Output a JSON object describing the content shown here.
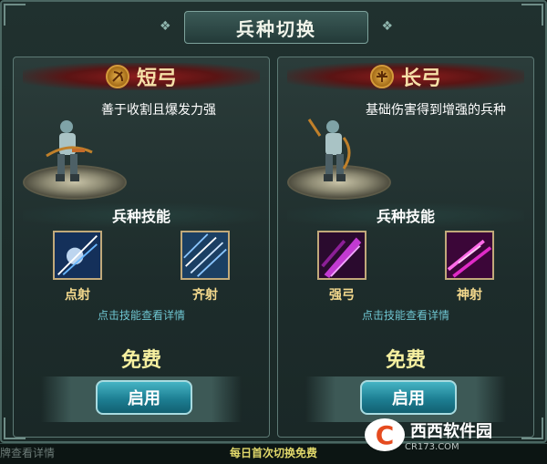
{
  "window": {
    "title": "兵种切换"
  },
  "panels": [
    {
      "type_name": "短弓",
      "description": "善于收割且爆发力强",
      "skills_heading": "兵种技能",
      "skills": [
        {
          "label": "点射"
        },
        {
          "label": "齐射"
        }
      ],
      "hint": "点击技能查看详情",
      "cost": "免费",
      "button_label": "启用"
    },
    {
      "type_name": "长弓",
      "description": "基础伤害得到增强的兵种",
      "skills_heading": "兵种技能",
      "skills": [
        {
          "label": "强弓"
        },
        {
          "label": "神射"
        }
      ],
      "hint": "点击技能查看详情",
      "cost": "免费",
      "button_label": "启用"
    }
  ],
  "footer": {
    "cut_text": "牌查看详情",
    "daily_note": "每日首次切换免费"
  },
  "watermark": {
    "logo_char": "C",
    "name": "西西软件园",
    "domain": "CR173.COM"
  },
  "colors": {
    "accent": "#46b4c4",
    "gold": "#f4d98d",
    "banner_red": "#8e1d1d"
  }
}
